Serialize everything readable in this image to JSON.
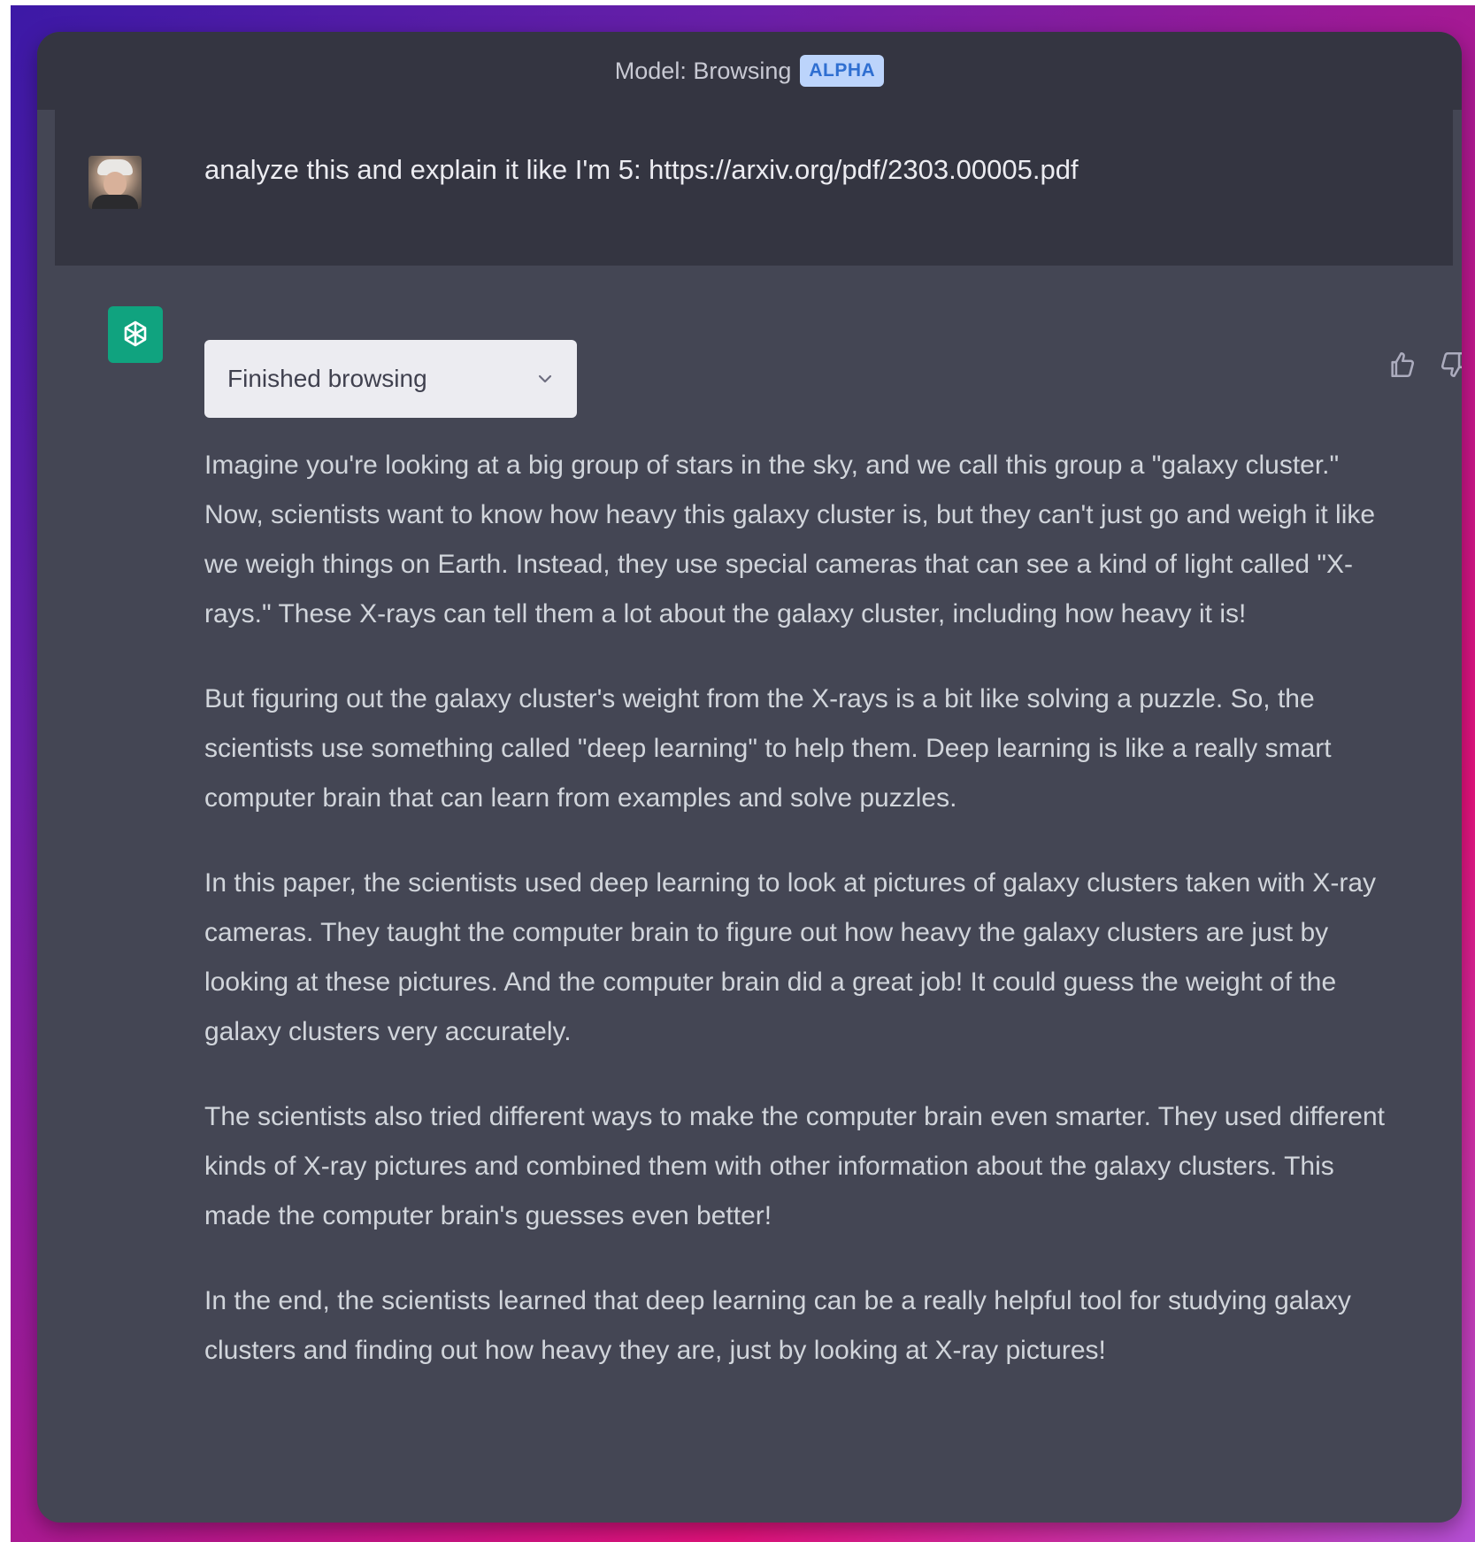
{
  "header": {
    "model_label": "Model: Browsing",
    "badge": "ALPHA"
  },
  "user_message": {
    "text": "analyze this and explain it like I'm 5: https://arxiv.org/pdf/2303.00005.pdf",
    "avatar_icon": "user-avatar"
  },
  "assistant": {
    "logo_icon": "openai-logo-icon",
    "browsing_status": "Finished browsing",
    "paragraphs": [
      "Imagine you're looking at a big group of stars in the sky, and we call this group a \"galaxy cluster.\" Now, scientists want to know how heavy this galaxy cluster is, but they can't just go and weigh it like we weigh things on Earth. Instead, they use special cameras that can see a kind of light called \"X-rays.\" These X-rays can tell them a lot about the galaxy cluster, including how heavy it is!",
      "But figuring out the galaxy cluster's weight from the X-rays is a bit like solving a puzzle. So, the scientists use something called \"deep learning\" to help them. Deep learning is like a really smart computer brain that can learn from examples and solve puzzles.",
      "In this paper, the scientists used deep learning to look at pictures of galaxy clusters taken with X-ray cameras. They taught the computer brain to figure out how heavy the galaxy clusters are just by looking at these pictures. And the computer brain did a great job! It could guess the weight of the galaxy clusters very accurately.",
      "The scientists also tried different ways to make the computer brain even smarter. They used different kinds of X-ray pictures and combined them with other information about the galaxy clusters. This made the computer brain's guesses even better!",
      "In the end, the scientists learned that deep learning can be a really helpful tool for studying galaxy clusters and finding out how heavy they are, just by looking at X-ray pictures!"
    ],
    "feedback_icons": [
      "thumbs-up-icon",
      "thumbs-down-icon"
    ]
  },
  "colors": {
    "panel": "#444654",
    "header": "#343541",
    "brand_green": "#10a37f",
    "badge_bg": "#bcd4fb",
    "badge_text": "#2f6fd1"
  }
}
